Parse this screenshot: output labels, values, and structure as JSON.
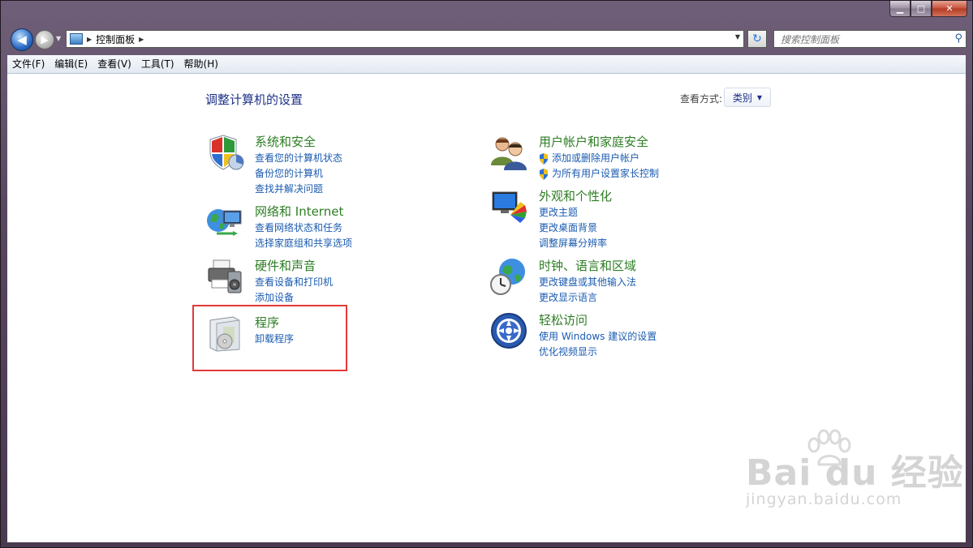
{
  "window": {
    "minimize_glyph": "▁",
    "maximize_glyph": "□",
    "close_glyph": "✕"
  },
  "nav": {
    "back_glyph": "◀",
    "forward_glyph": "▶",
    "breadcrumb": "控制面板",
    "search_placeholder": "搜索控制面板"
  },
  "menu": {
    "file": "文件(F)",
    "edit": "编辑(E)",
    "view": "查看(V)",
    "tools": "工具(T)",
    "help": "帮助(H)"
  },
  "page": {
    "title": "调整计算机的设置",
    "view_by_label": "查看方式:",
    "view_by_value": "类别"
  },
  "categories": {
    "system_security": {
      "title": "系统和安全",
      "icon": "shield-icon",
      "links": [
        "查看您的计算机状态",
        "备份您的计算机",
        "查找并解决问题"
      ]
    },
    "network": {
      "title": "网络和 Internet",
      "icon": "network-globe-icon",
      "links": [
        "查看网络状态和任务",
        "选择家庭组和共享选项"
      ]
    },
    "hardware": {
      "title": "硬件和声音",
      "icon": "printer-speaker-icon",
      "links": [
        "查看设备和打印机",
        "添加设备"
      ]
    },
    "programs": {
      "title": "程序",
      "icon": "programs-box-icon",
      "links": [
        "卸载程序"
      ]
    },
    "user_accounts": {
      "title": "用户帐户和家庭安全",
      "icon": "users-icon",
      "links": [
        "添加或删除用户帐户",
        "为所有用户设置家长控制"
      ]
    },
    "appearance": {
      "title": "外观和个性化",
      "icon": "monitor-palette-icon",
      "links": [
        "更改主题",
        "更改桌面背景",
        "调整屏幕分辨率"
      ]
    },
    "clock_region": {
      "title": "时钟、语言和区域",
      "icon": "clock-globe-icon",
      "links": [
        "更改键盘或其他输入法",
        "更改显示语言"
      ]
    },
    "ease_access": {
      "title": "轻松访问",
      "icon": "ease-of-access-icon",
      "links": [
        "使用 Windows 建议的设置",
        "优化视频显示"
      ]
    }
  },
  "watermark": {
    "brand": "Bai du 经验",
    "url": "jingyan.baidu.com"
  },
  "colors": {
    "category_title": "#2d7d23",
    "link": "#1a5bb0",
    "highlight": "#e23a3a"
  }
}
